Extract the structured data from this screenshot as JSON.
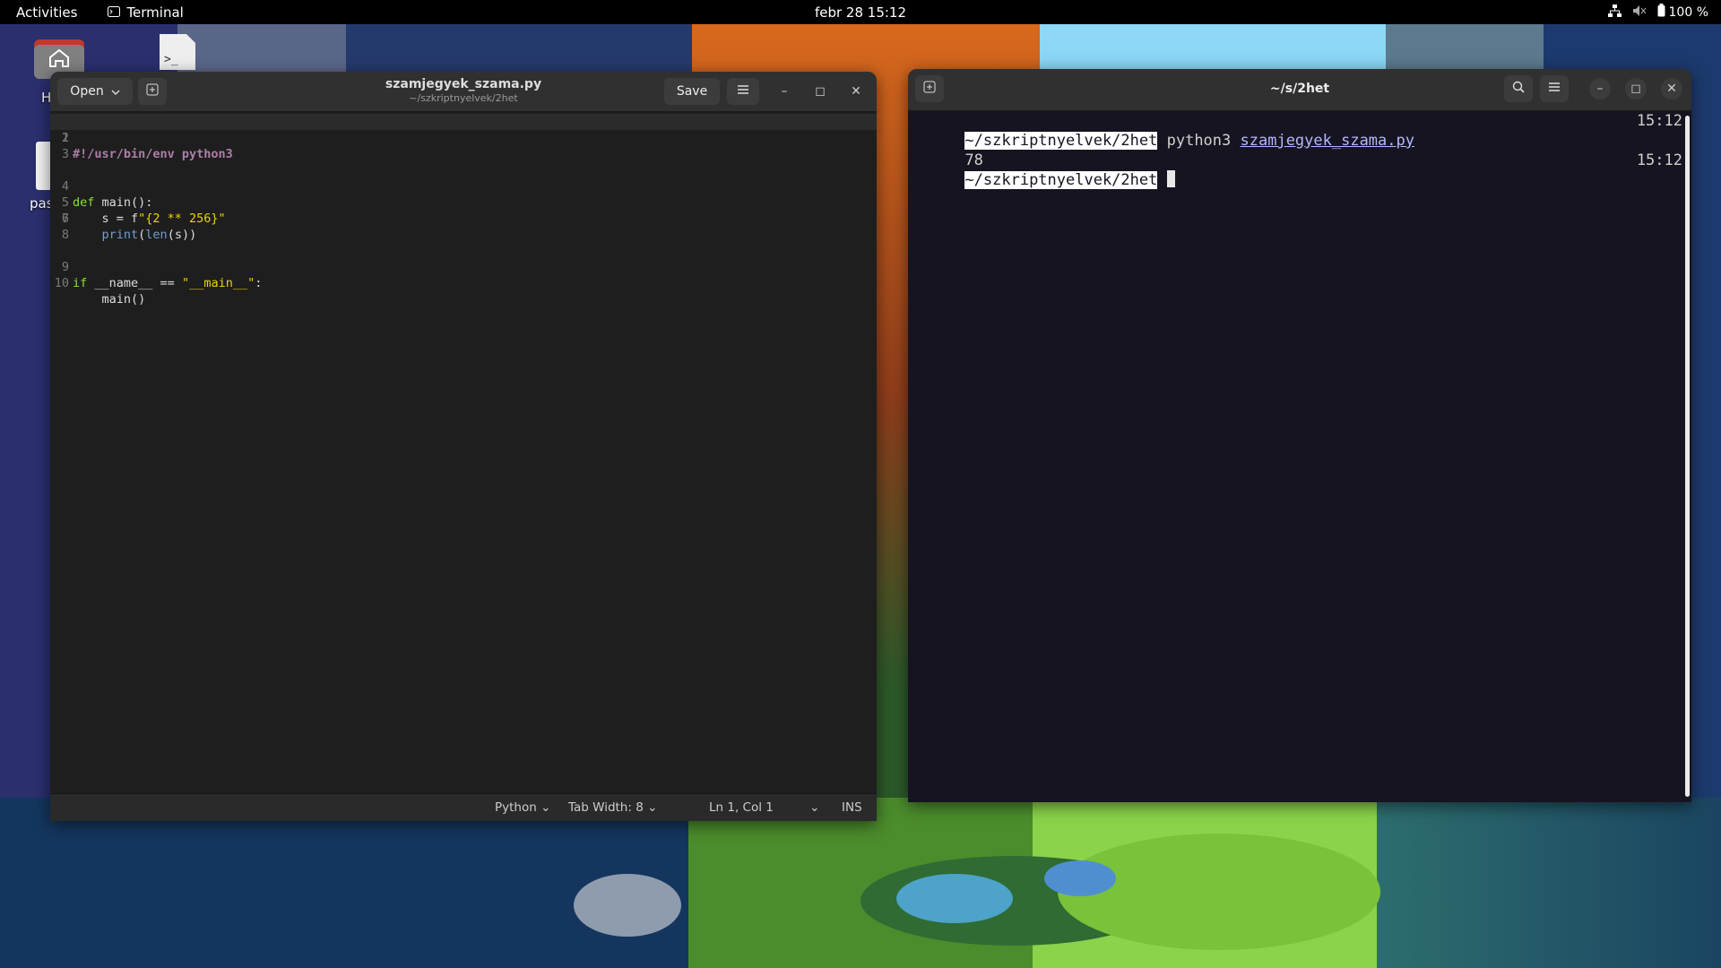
{
  "topbar": {
    "activities": "Activities",
    "app_name": "Terminal",
    "clock": "febr 28  15:12",
    "battery": "100 %"
  },
  "desktop": {
    "icons": [
      {
        "label": "H",
        "icon": "home-folder-icon"
      },
      {
        "label": "pas",
        "icon": "document-icon"
      }
    ]
  },
  "gedit": {
    "open_label": "Open",
    "title": "szamjegyek_szama.py",
    "subtitle": "~/szkriptnyelvek/2het",
    "save_label": "Save",
    "code_lines": [
      "#!/usr/bin/env python3",
      "",
      "",
      "def main():",
      "    s = f\"{2 ** 256}\"",
      "    print(len(s))",
      "",
      "",
      "if __name__ == \"__main__\":",
      "    main()"
    ],
    "status": {
      "language": "Python",
      "tab_width": "Tab Width: 8",
      "position": "Ln 1, Col 1",
      "mode": "INS"
    }
  },
  "terminal": {
    "title": "~/s/2het",
    "lines": [
      {
        "prompt": "~/szkriptnyelvek/2het",
        "command": "python3",
        "arg": "szamjegyek_szama.py",
        "time": "15:12"
      },
      {
        "output": "78"
      },
      {
        "prompt": "~/szkriptnyelvek/2het",
        "command": "",
        "arg": "",
        "time": "15:12"
      }
    ]
  },
  "colors": {
    "terminal_bg": "#171421",
    "editor_bg": "#1e1e1e",
    "keyword": "#8ae234",
    "string": "#edd400"
  }
}
